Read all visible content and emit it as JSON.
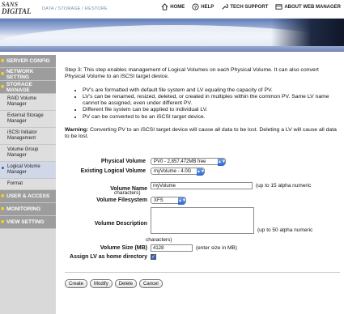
{
  "brand": {
    "line1": "SANS",
    "line2": "DIGITAL"
  },
  "breadcrumb": "DATA / STORAGE / RESTORE",
  "topnav": [
    {
      "label": "HOME",
      "icon": "home-icon"
    },
    {
      "label": "HELP",
      "icon": "help-icon"
    },
    {
      "label": "TECH SUPPORT",
      "icon": "wrench-icon"
    },
    {
      "label": "ABOUT WEB MANAGER",
      "icon": "web-icon"
    }
  ],
  "sidebar": {
    "server_config": "SERVER CONFIG",
    "network_setting": "NETWORK SETTING",
    "storage_manage": "STORAGE MANAGE",
    "sub": {
      "raid": "RAID Volume Manager",
      "external": "External Storage Manager",
      "iscsi": "iSCSI Initiator Management",
      "volume_group": "Volume Group Manager",
      "logical": "Logical Volume Manager",
      "format": "Format"
    },
    "user_access": "USER & ACCESS",
    "monitoring": "MONITORING",
    "view_setting": "VIEW SETTING"
  },
  "content": {
    "intro": "Step 3: This step enables management of Logical Volumes on each Physical Volume. It can also convert Physical Volume to an iSCSI target device.",
    "bullets": [
      "PV's are formatted with default file system and LV equaling the capacity of PV.",
      "LV's can be renamed, resized, deleted, or created in multiples within the common PV. Same LV name cannot be assigned, even under different PV.",
      "Different file system can be applied to individual LV.",
      "PV can be converted to be an iSCSI target device."
    ],
    "warning_label": "Warning:",
    "warning_text": " Converting PV to an iSCSI target device will cause all data to be lost. Deleting a LV will cause all data to be lost."
  },
  "form": {
    "physical_volume_label": "Physical Volume",
    "physical_volume_value": "PV0 - 2,857,472MB free",
    "existing_lv_label": "Existing Logical Volume",
    "existing_lv_value": "myVolume - 4.0G",
    "volume_name_label": "Volume Name",
    "volume_name_value": "myVolume",
    "volume_name_note_a": "(up to 15 alpha numeric",
    "volume_name_note_b": "characters)",
    "filesystem_label": "Volume Filesystem",
    "filesystem_value": "XFS",
    "description_label": "Volume Description",
    "description_value": "",
    "description_note_a": "(up to 50 alpha numeric",
    "description_note_b": "characters)",
    "size_label": "Volume Size (MB)",
    "size_value": "4128",
    "size_note": "(enter size in MB)",
    "home_dir_label": "Assign LV as home directory",
    "home_dir_checked": true
  },
  "buttons": {
    "create": "Create",
    "modify": "Modify",
    "delete": "Delete",
    "cancel": "Cancel"
  }
}
